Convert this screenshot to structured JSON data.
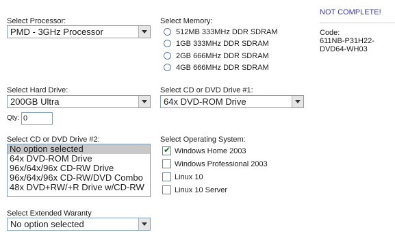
{
  "processor": {
    "label": "Select Processor:",
    "selected": "PMD - 3GHz Processor"
  },
  "memory": {
    "label": "Select Memory:",
    "options": [
      "512MB 333MHz DDR SDRAM",
      "1GB 333MHz DDR SDRAM",
      "2GB 666MHz DDR SDRAM",
      "4GB 666MHz DDR SDRAM"
    ]
  },
  "status": {
    "text": "NOT COMPLETE!",
    "code_label": "Code:",
    "code_line1": "611NB-P31H22-",
    "code_line2": "DVD64-WH03"
  },
  "hard_drive": {
    "label": "Select Hard Drive:",
    "selected": "200GB Ultra",
    "qty_label": "Qty:",
    "qty_value": "0"
  },
  "cd_dvd_1": {
    "label": "Select CD or DVD Drive #1:",
    "selected": "64x DVD-ROM Drive"
  },
  "cd_dvd_2": {
    "label": "Select CD or DVD Drive #2:",
    "options": [
      "No option selected",
      "64x DVD-ROM Drive",
      "96x/64x/96x CD-RW Drive",
      "96x/64x/96x CD-RW/DVD Combo",
      "48x DVD+RW/+R Drive w/CD-RW"
    ],
    "selected_index": 0
  },
  "os": {
    "label": "Select Operating System:",
    "options": [
      {
        "text": "Windows Home 2003",
        "checked": true
      },
      {
        "text": "Windows Professional 2003",
        "checked": false
      },
      {
        "text": "Linux 10",
        "checked": false
      },
      {
        "text": "Linux 10 Server",
        "checked": false
      }
    ]
  },
  "warranty": {
    "label": "Select Extended Waranty",
    "selected": "No option selected"
  },
  "colors": {
    "status": "#3a3aa0",
    "checkmark": "#1d6b1d"
  }
}
